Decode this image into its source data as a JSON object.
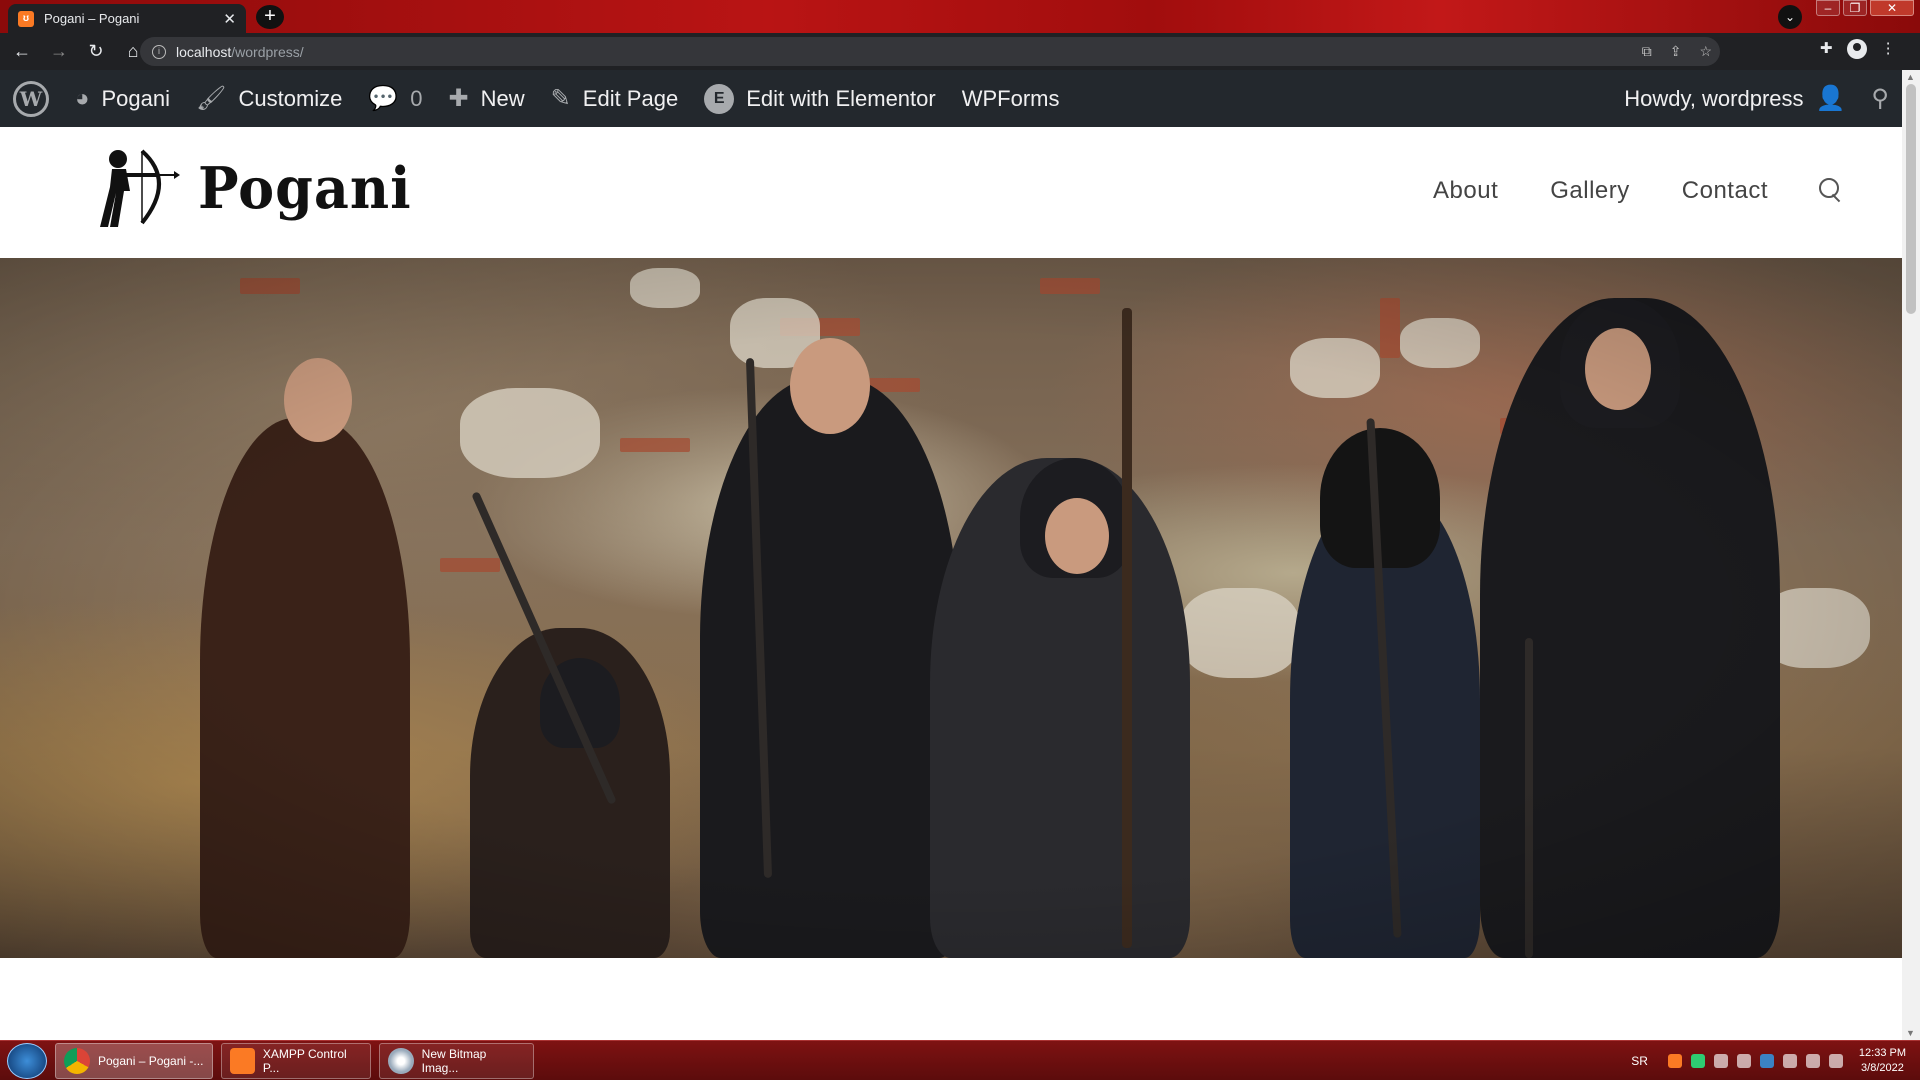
{
  "browser": {
    "tab_title": "Pogani – Pogani",
    "tab_favicon": "xampp-icon",
    "url_host": "localhost",
    "url_path": "/wordpress/"
  },
  "adminbar": {
    "site_name": "Pogani",
    "customize": "Customize",
    "comments_count": "0",
    "new": "New",
    "edit_page": "Edit Page",
    "edit_elementor": "Edit with Elementor",
    "wpforms": "WPForms",
    "howdy": "Howdy, wordpress"
  },
  "site": {
    "logo_text": "Pogani",
    "nav": [
      "About",
      "Gallery",
      "Contact"
    ]
  },
  "taskbar": {
    "items": [
      "Pogani – Pogani -...",
      "XAMPP Control P...",
      "New Bitmap Imag..."
    ],
    "lang": "SR",
    "time": "12:33 PM",
    "date": "3/8/2022"
  },
  "colors": {
    "adminbar_bg": "#23282d",
    "titlebar_accent": "#b91414",
    "taskbar_bg": "#5c0c0c"
  }
}
